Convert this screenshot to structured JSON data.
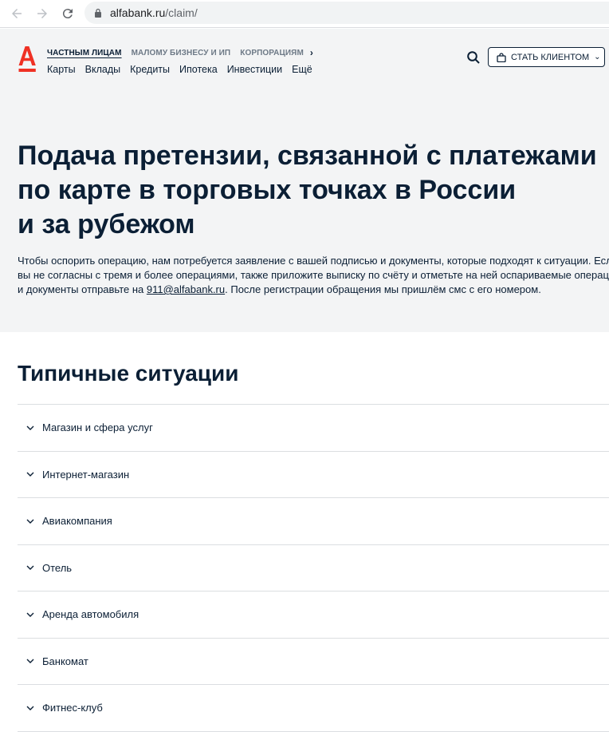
{
  "browser": {
    "url_host": "alfabank.ru",
    "url_path": "/claim/"
  },
  "header": {
    "segments": [
      "ЧАСТНЫМ ЛИЦАМ",
      "МАЛОМУ БИЗНЕСУ И ИП",
      "КОРПОРАЦИЯМ"
    ],
    "menu": [
      "Карты",
      "Вклады",
      "Кредиты",
      "Ипотека",
      "Инвестиции",
      "Ещё"
    ],
    "client_button": "СТАТЬ КЛИЕНТОМ"
  },
  "hero": {
    "title_lines": [
      "Подача претензии, связанной с платежами",
      "по карте в торговых точках в России",
      "и за рубежом"
    ],
    "intro_line1": "Чтобы оспорить операцию, нам потребуется заявление с вашей подписью и документы, которые подходят к ситуации. Если",
    "intro_line2": "вы не согласны с тремя и более операциями, также приложите выписку по счёту и отметьте на ней оспариваемые операции.",
    "intro_line3_pre": "и документы отправьте на ",
    "intro_email": "911@alfabank.ru",
    "intro_line3_post": ". После регистрации обращения мы пришлём смс с его номером."
  },
  "situations": {
    "title": "Типичные ситуации",
    "items": [
      "Магазин и сфера услуг",
      "Интернет-магазин",
      "Авиакомпания",
      "Отель",
      "Аренда автомобиля",
      "Банкомат",
      "Фитнес-клуб"
    ]
  },
  "colors": {
    "brand_red": "#ef3124",
    "text_dark": "#0b1f35",
    "hero_bg": "#f3f4f5"
  }
}
